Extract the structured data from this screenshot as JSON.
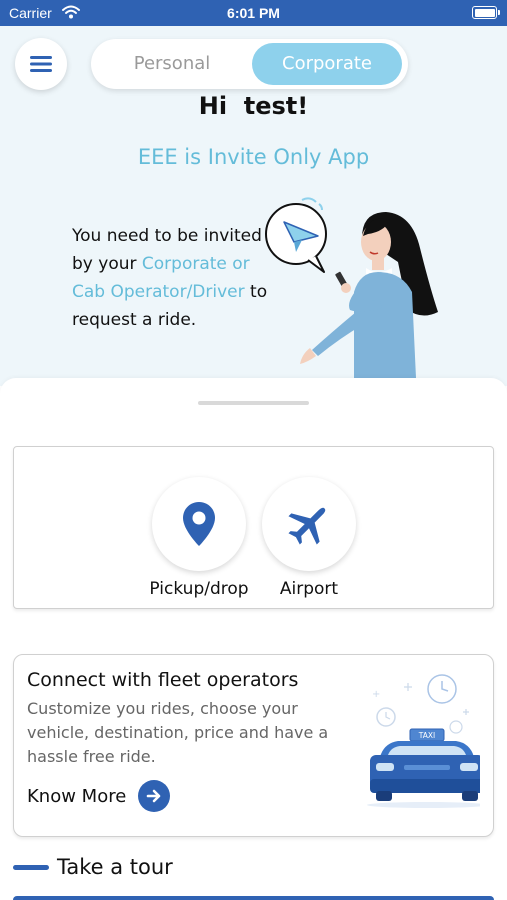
{
  "status_bar": {
    "carrier": "Carrier",
    "time": "6:01 PM"
  },
  "header": {
    "menu_icon": "hamburger-menu-icon",
    "tabs": [
      {
        "label": "Personal",
        "active": false
      },
      {
        "label": "Corporate",
        "active": true
      }
    ]
  },
  "hero": {
    "greeting": "Hi  test!",
    "subtitle": "EEE is Invite Only App",
    "message_parts": {
      "p1": "You need to be invited by your ",
      "highlight": "Corporate or Cab Operator/Driver",
      "p2": " to request a ride."
    },
    "illustration_icon": "woman-with-phone-send-icon"
  },
  "services": [
    {
      "label": "Pickup/drop",
      "icon": "location-pin-icon"
    },
    {
      "label": "Airport",
      "icon": "airplane-icon"
    }
  ],
  "fleet_card": {
    "title": "Connect with fleet operators",
    "description": "Customize you rides, choose your vehicle, destination, price and have a hassle free ride.",
    "cta_label": "Know More",
    "cta_icon": "arrow-right-icon",
    "illustration_icon": "taxi-car-icon",
    "taxi_sign": "TAXI"
  },
  "tour": {
    "label": "Take a tour"
  },
  "colors": {
    "primary": "#2f62b3",
    "accent": "#64bcd9",
    "segment_active": "#8ed1ec",
    "hero_bg": "#eef6fa"
  }
}
